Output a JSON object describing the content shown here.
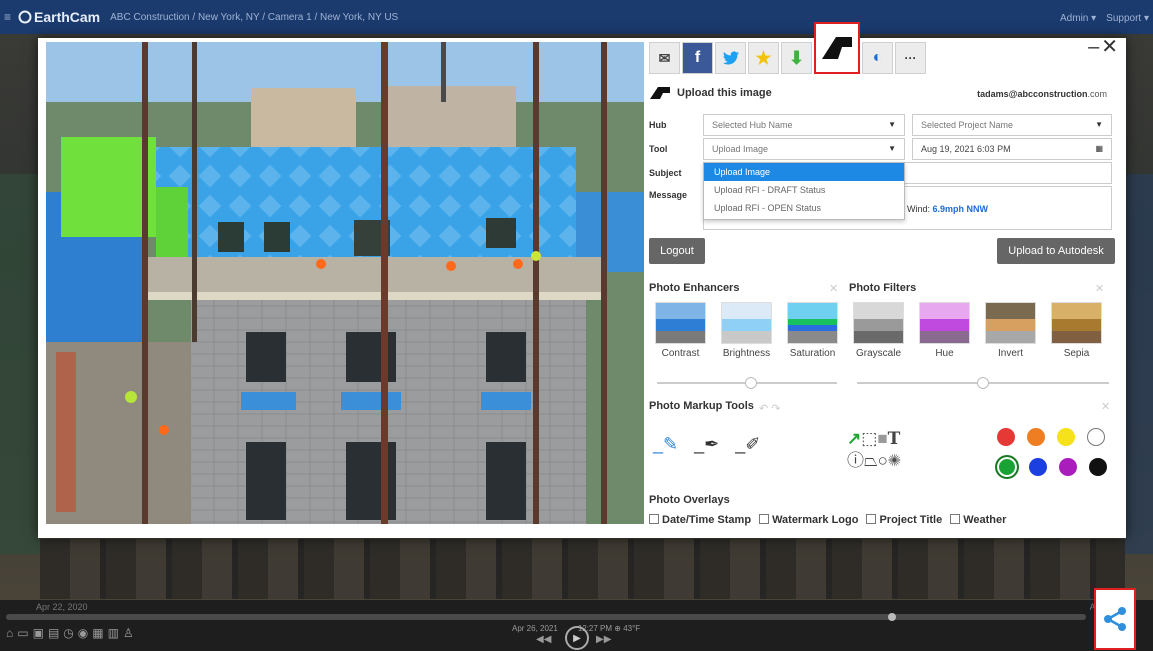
{
  "topbar": {
    "logo": "EarthCam",
    "breadcrumb": "ABC Construction  /  New York, NY  /  Camera 1  /  New York, NY US",
    "admin": "Admin ▾",
    "support": "Support ▾"
  },
  "timeline": {
    "left_date": "Apr 22, 2020",
    "right_date": "Aug 2",
    "current_date": "Apr 26, 2021",
    "current_time": "12:27 PM ⊕ 43°F"
  },
  "share_buttons": [
    {
      "icon": "mail-icon"
    },
    {
      "icon": "facebook-icon"
    },
    {
      "icon": "twitter-icon"
    },
    {
      "icon": "star-icon"
    },
    {
      "icon": "download-icon"
    },
    {
      "icon": "autodesk-icon"
    },
    {
      "icon": "globe-icon"
    },
    {
      "icon": "more-icon",
      "label": "···"
    }
  ],
  "upload": {
    "title": "Upload this image",
    "user": "tadams@abcconstruction",
    "user_suffix": ".com",
    "labels": {
      "hub": "Hub",
      "tool": "Tool",
      "subject": "Subject",
      "message": "Message"
    },
    "hub_placeholder": "Selected Hub Name",
    "project_placeholder": "Selected Project Name",
    "tool_value": "Upload Image",
    "date_value": "Aug 19, 2021 6:03 PM",
    "dropdown_options": [
      "Upload Image",
      "Upload RFI - DRAFT Status",
      "Upload RFI - OPEN Status"
    ],
    "weather_prefix": ", Wind:",
    "weather_value": "6.9mph NNW",
    "logout": "Logout",
    "upload_button": "Upload to Autodesk"
  },
  "enhancers": {
    "title": "Photo Enhancers",
    "items": [
      "Contrast",
      "Brightness",
      "Saturation"
    ]
  },
  "filters": {
    "title": "Photo Filters",
    "items": [
      "Grayscale",
      "Hue",
      "Invert",
      "Sepia"
    ]
  },
  "markup": {
    "title": "Photo Markup Tools",
    "colors": [
      "#e53935",
      "#ef7d22",
      "#f5e21a",
      "#ffffff",
      "#1aa335",
      "#1c3fe0",
      "#a81dbb",
      "#111111"
    ]
  },
  "overlays": {
    "title": "Photo Overlays",
    "options": [
      "Date/Time Stamp",
      "Watermark Logo",
      "Project Title",
      "Weather"
    ]
  }
}
